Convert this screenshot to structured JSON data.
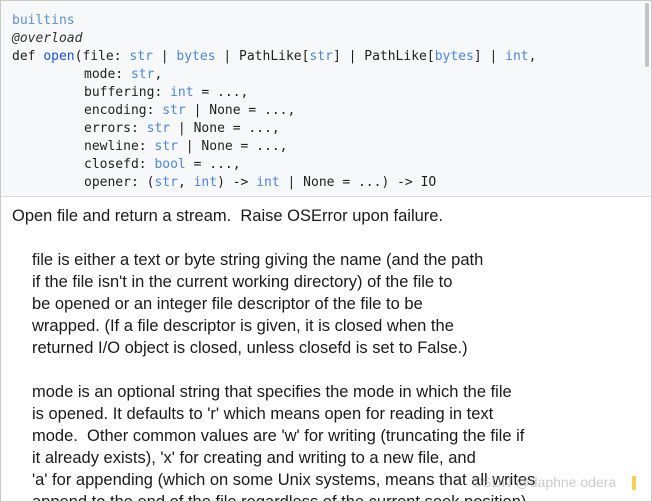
{
  "signature": {
    "module": "builtins",
    "decorator": "@overload",
    "def_keyword": "def",
    "function_name": "open",
    "line1": {
      "open_paren": "(",
      "param": "file: ",
      "t1": "str",
      "sep1": " | ",
      "t2": "bytes",
      "sep2": " | PathLike[",
      "t3": "str",
      "sep3": "] | PathLike[",
      "t4": "bytes",
      "sep4": "] | ",
      "t5": "int",
      "end": ","
    },
    "params": [
      {
        "name": "mode: ",
        "type": "str",
        "rest": ","
      },
      {
        "name": "buffering: ",
        "type": "int",
        "rest": " = ...,"
      },
      {
        "name": "encoding: ",
        "type": "str",
        "rest": " | None = ...,"
      },
      {
        "name": "errors: ",
        "type": "str",
        "rest": " | None = ...,"
      },
      {
        "name": "newline: ",
        "type": "str",
        "rest": " | None = ...,"
      },
      {
        "name": "closefd: ",
        "type": "bool",
        "rest": " = ...,"
      }
    ],
    "opener": {
      "prefix": "opener: (",
      "t1": "str",
      "sep": ", ",
      "t2": "int",
      "arrow": ") -> ",
      "t3": "int",
      "rest": " | None = ...) -> IO"
    }
  },
  "doc": {
    "summary": "Open file and return a stream.  Raise OSError upon failure.",
    "para1": [
      "file is either a text or byte string giving the name (and the path",
      "if the file isn't in the current working directory) of the file to",
      "be opened or an integer file descriptor of the file to be",
      "wrapped. (If a file descriptor is given, it is closed when the",
      "returned I/O object is closed, unless closefd is set to False.)"
    ],
    "para2": [
      "mode is an optional string that specifies the mode in which the file",
      "is opened. It defaults to 'r' which means open for reading in text",
      "mode.  Other common values are 'w' for writing (truncating the file if",
      "it already exists), 'x' for creating and writing to a new file, and",
      "'a' for appending (which on some Unix systems, means that all writes",
      "append to the end of the file regardless of the current seek position)."
    ]
  },
  "watermark": "CSDN @daphne odera"
}
